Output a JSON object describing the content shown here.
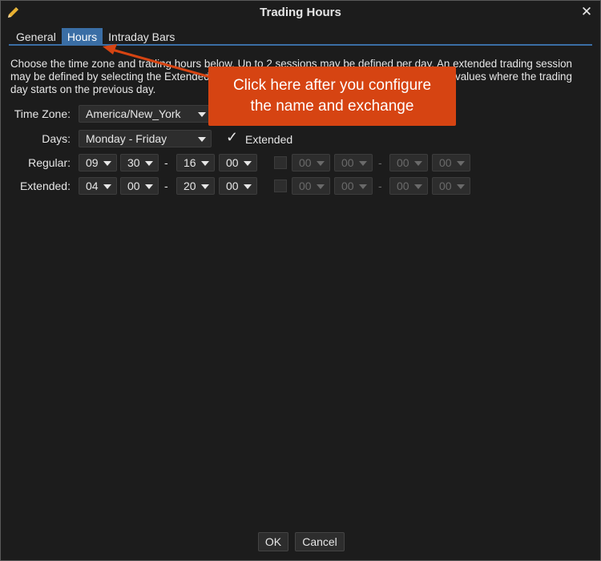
{
  "window": {
    "title": "Trading Hours",
    "close_glyph": "✕",
    "icon": "pencil-icon"
  },
  "tabs": [
    {
      "label": "General",
      "active": false
    },
    {
      "label": "Hours",
      "active": true
    },
    {
      "label": "Intraday Bars",
      "active": false
    }
  ],
  "description": "Choose the time zone and trading hours below.  Up to 2 sessions may be defined per day.  An extended trading session may be defined by selecting the Extended checkbox.  The end time may be less than the start values where the trading day starts on the previous day.",
  "form": {
    "timezone_label": "Time Zone:",
    "timezone_value": "America/New_York",
    "days_label": "Days:",
    "days_value": "Monday - Friday",
    "extended_checkbox_label": "Extended",
    "extended_checked": true,
    "regular_label": "Regular:",
    "extended_label": "Extended:",
    "dash": "-",
    "regular_session1": {
      "start_hour": "09",
      "start_min": "30",
      "end_hour": "16",
      "end_min": "00"
    },
    "extended_session1": {
      "start_hour": "04",
      "start_min": "00",
      "end_hour": "20",
      "end_min": "00"
    },
    "regular_session2": {
      "enabled": false,
      "start_hour": "00",
      "start_min": "00",
      "end_hour": "00",
      "end_min": "00"
    },
    "extended_session2": {
      "enabled": false,
      "start_hour": "00",
      "start_min": "00",
      "end_hour": "00",
      "end_min": "00"
    }
  },
  "buttons": {
    "ok": "OK",
    "cancel": "Cancel"
  },
  "callout": {
    "line1": "Click here after you configure",
    "line2": "the name and exchange",
    "color": "#d64412"
  },
  "colors": {
    "background": "#1c1c1c",
    "accent": "#3a6ea5",
    "text": "#e6e6e6"
  }
}
